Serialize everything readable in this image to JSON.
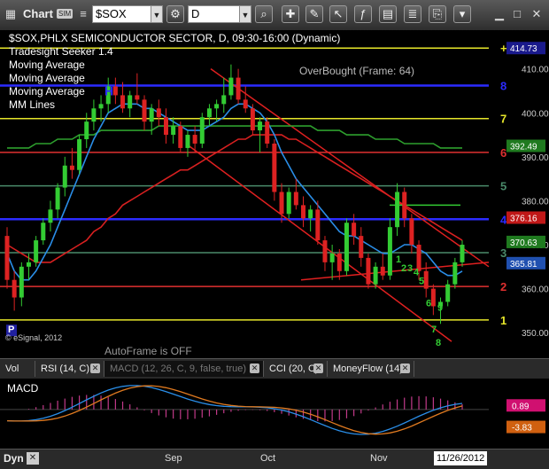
{
  "toolbar": {
    "window_title": "Chart",
    "badge": "SIM",
    "symbol": "$SOX",
    "interval": "D"
  },
  "chart_data": {
    "type": "candlestick",
    "title": "$SOX,PHLX SEMICONDUCTOR SECTOR, D, 09:30-16:00 (Dynamic)",
    "studies": [
      "Tradesight Seeker 1.4",
      "Moving Average",
      "Moving Average",
      "Moving Average",
      "MM Lines"
    ],
    "ylim": [
      345,
      418
    ],
    "yticks": [
      350,
      360,
      370,
      380,
      390,
      400,
      410
    ],
    "xticks": [
      "Sep",
      "Oct",
      "Nov"
    ],
    "copyright": "© eSignal, 2012",
    "autoframe": "AutoFrame is OFF",
    "overbought": "OverBought (Frame: 64)",
    "mm_lines": [
      {
        "label": "+",
        "value": 414.73,
        "color": "#e6e62a"
      },
      {
        "label": "8",
        "value": 406.2,
        "color": "#2b2bff"
      },
      {
        "label": "7",
        "value": 398.7,
        "color": "#e6e62a"
      },
      {
        "label": "6",
        "value": 391.0,
        "color": "#e03030"
      },
      {
        "label": "5",
        "value": 383.4,
        "color": "#4a8a6a"
      },
      {
        "label": "4",
        "value": 375.8,
        "color": "#2b2bff"
      },
      {
        "label": "3",
        "value": 368.2,
        "color": "#4a8a6a"
      },
      {
        "label": "2",
        "value": 360.5,
        "color": "#e03030"
      },
      {
        "label": "1",
        "value": 352.9,
        "color": "#e6e62a"
      }
    ],
    "price_labels": [
      {
        "text": "414.73",
        "value": 414.73,
        "bg": "#1a1a8c"
      },
      {
        "text": "392.49",
        "value": 392.49,
        "bg": "#1f7a1f"
      },
      {
        "text": "376.16",
        "value": 376.16,
        "bg": "#c01818"
      },
      {
        "text": "370.63",
        "value": 370.63,
        "bg": "#1f7a1f"
      },
      {
        "text": "365.81",
        "value": 365.81,
        "bg": "#2050b0"
      }
    ],
    "candles": [
      [
        372,
        374,
        360,
        362
      ],
      [
        362,
        364,
        355,
        358
      ],
      [
        358,
        366,
        356,
        365
      ],
      [
        365,
        368,
        362,
        366
      ],
      [
        366,
        372,
        365,
        371
      ],
      [
        371,
        376,
        370,
        375
      ],
      [
        375,
        380,
        373,
        378
      ],
      [
        378,
        384,
        376,
        383
      ],
      [
        383,
        390,
        381,
        388
      ],
      [
        388,
        392,
        385,
        387
      ],
      [
        387,
        395,
        386,
        394
      ],
      [
        394,
        400,
        392,
        398
      ],
      [
        398,
        403,
        396,
        401
      ],
      [
        401,
        404,
        398,
        402
      ],
      [
        402,
        408,
        400,
        406
      ],
      [
        406,
        408,
        402,
        404
      ],
      [
        404,
        407,
        400,
        401
      ],
      [
        401,
        405,
        399,
        404
      ],
      [
        404,
        409,
        402,
        403
      ],
      [
        403,
        404,
        396,
        398
      ],
      [
        398,
        402,
        395,
        401
      ],
      [
        401,
        403,
        397,
        399
      ],
      [
        399,
        401,
        393,
        395
      ],
      [
        395,
        399,
        393,
        397
      ],
      [
        397,
        398,
        391,
        392
      ],
      [
        392,
        396,
        390,
        395
      ],
      [
        395,
        397,
        391,
        393
      ],
      [
        393,
        400,
        392,
        399
      ],
      [
        399,
        402,
        397,
        401
      ],
      [
        401,
        403,
        398,
        402
      ],
      [
        402,
        408,
        400,
        404
      ],
      [
        404,
        411,
        403,
        408
      ],
      [
        408,
        410,
        402,
        403
      ],
      [
        403,
        406,
        400,
        401
      ],
      [
        401,
        402,
        395,
        396
      ],
      [
        396,
        399,
        391,
        398
      ],
      [
        398,
        399,
        392,
        393
      ],
      [
        393,
        394,
        380,
        382
      ],
      [
        382,
        384,
        375,
        377
      ],
      [
        377,
        383,
        376,
        382
      ],
      [
        382,
        385,
        378,
        379
      ],
      [
        379,
        381,
        374,
        376
      ],
      [
        376,
        379,
        373,
        378
      ],
      [
        378,
        380,
        370,
        371
      ],
      [
        371,
        372,
        364,
        366
      ],
      [
        366,
        370,
        362,
        368
      ],
      [
        368,
        369,
        362,
        364
      ],
      [
        364,
        376,
        363,
        375
      ],
      [
        375,
        377,
        370,
        372
      ],
      [
        372,
        374,
        365,
        367
      ],
      [
        367,
        368,
        360,
        361
      ],
      [
        361,
        366,
        360,
        365
      ],
      [
        365,
        368,
        362,
        363
      ],
      [
        363,
        376,
        362,
        374
      ],
      [
        374,
        384,
        372,
        382
      ],
      [
        382,
        383,
        374,
        376
      ],
      [
        376,
        377,
        368,
        370
      ],
      [
        370,
        371,
        362,
        364
      ],
      [
        364,
        366,
        358,
        360
      ],
      [
        360,
        361,
        354,
        356
      ],
      [
        356,
        358,
        352,
        357
      ],
      [
        357,
        362,
        356,
        361
      ],
      [
        361,
        367,
        360,
        366
      ],
      [
        366,
        371,
        365,
        370
      ]
    ],
    "ma_blue": [
      368,
      364,
      362,
      362,
      364,
      367,
      370,
      374,
      378,
      382,
      386,
      390,
      394,
      397,
      400,
      401,
      402,
      402,
      402,
      401,
      401,
      400,
      399,
      398,
      397,
      396,
      396,
      396,
      397,
      398,
      399,
      401,
      402,
      402,
      401,
      400,
      398,
      395,
      391,
      388,
      385,
      383,
      381,
      379,
      377,
      375,
      373,
      372,
      372,
      371,
      370,
      369,
      368,
      368,
      369,
      370,
      370,
      369,
      368,
      366,
      364,
      363,
      363,
      364
    ],
    "ma_red": [
      370,
      369,
      368,
      367,
      366,
      366,
      366,
      367,
      368,
      369,
      370,
      371,
      373,
      374,
      376,
      377,
      379,
      380,
      381,
      382,
      383,
      384,
      385,
      386,
      387,
      387,
      388,
      389,
      390,
      391,
      392,
      393,
      394,
      394,
      395,
      395,
      395,
      395,
      395,
      394,
      394,
      393,
      392,
      391,
      390,
      389,
      388,
      387,
      386,
      385,
      384,
      383,
      382,
      381,
      380,
      379,
      378,
      377,
      376,
      375,
      374,
      373,
      372,
      371
    ],
    "ma_green": [
      392,
      392,
      392,
      392,
      393,
      393,
      393,
      394,
      394,
      394,
      395,
      395,
      395,
      396,
      396,
      396,
      396,
      396,
      396,
      396,
      396,
      397,
      397,
      397,
      397,
      397,
      397,
      397,
      397,
      397,
      397,
      397,
      397,
      397,
      397,
      397,
      397,
      397,
      397,
      397,
      397,
      397,
      397,
      396,
      396,
      396,
      396,
      395,
      395,
      395,
      395,
      394,
      394,
      394,
      394,
      393,
      393,
      393,
      393,
      393,
      392,
      392,
      392,
      392
    ],
    "annotations": [
      {
        "text": "H",
        "color": "#2b2bff"
      },
      {
        "text": "P",
        "color": "#ffffff"
      },
      {
        "text": "1",
        "color": "#33cc33"
      },
      {
        "text": "2",
        "color": "#33cc33"
      },
      {
        "text": "3",
        "color": "#33cc33"
      },
      {
        "text": "4",
        "color": "#33cc33"
      },
      {
        "text": "5",
        "color": "#33cc33"
      },
      {
        "text": "6",
        "color": "#33cc33"
      },
      {
        "text": "7",
        "color": "#33cc33"
      },
      {
        "text": "8",
        "color": "#33cc33"
      },
      {
        "text": "9",
        "color": "#33cc33"
      }
    ],
    "macd": {
      "title": "MACD",
      "ylim": [
        -8,
        6
      ],
      "labels": [
        {
          "text": "0.89",
          "value": 0.89,
          "bg": "#d01070"
        },
        {
          "text": "-3.83",
          "value": -3.83,
          "bg": "#d06010"
        }
      ]
    },
    "last_date": "11/26/2012"
  },
  "tabs": [
    {
      "label": "Vol",
      "closable": false
    },
    {
      "label": "RSI (14, C)",
      "closable": true
    },
    {
      "label": "MACD (12, 26, C, 9, false, true)",
      "closable": true,
      "active": true
    },
    {
      "label": "CCI (20, C)",
      "closable": true
    },
    {
      "label": "MoneyFlow (14)",
      "closable": true
    }
  ],
  "bottombar": {
    "dyn_label": "Dyn"
  }
}
